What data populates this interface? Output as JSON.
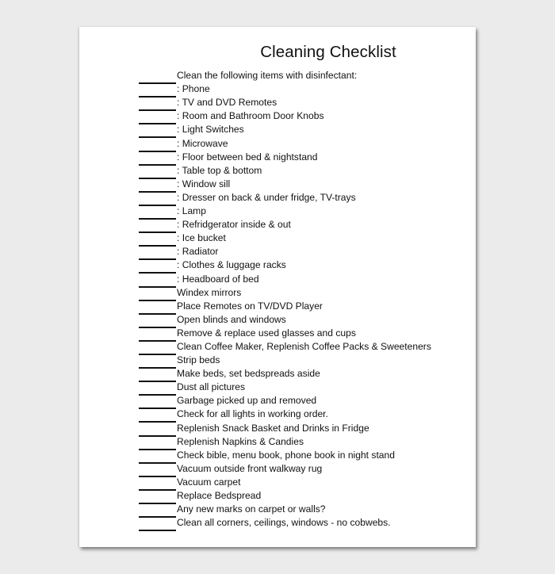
{
  "document": {
    "title": "Cleaning Checklist",
    "items": [
      "Clean the following items with disinfectant:",
      ": Phone",
      ": TV and DVD Remotes",
      ": Room and Bathroom Door Knobs",
      ": Light Switches",
      ": Microwave",
      ": Floor between bed & nightstand",
      ": Table top & bottom",
      ": Window sill",
      ": Dresser on back & under fridge, TV-trays",
      ": Lamp",
      ": Refridgerator inside & out",
      ": Ice bucket",
      ": Radiator",
      ": Clothes & luggage racks",
      ": Headboard of bed",
      "Windex mirrors",
      "Place Remotes on TV/DVD Player",
      "Open blinds and windows",
      "Remove & replace used glasses and cups",
      "Clean Coffee Maker, Replenish Coffee Packs & Sweeteners",
      "Strip beds",
      "Make beds, set bedspreads aside",
      "Dust all pictures",
      "Garbage picked up and removed",
      "Check for all lights in working order.",
      "Replenish Snack Basket and Drinks in Fridge",
      "Replenish Napkins & Candies",
      "Check bible, menu book, phone book in night stand",
      "Vacuum outside front walkway rug",
      "Vacuum carpet",
      "Replace Bedspread",
      "Any new marks on carpet or walls?",
      "Clean all corners, ceilings, windows - no cobwebs."
    ]
  }
}
